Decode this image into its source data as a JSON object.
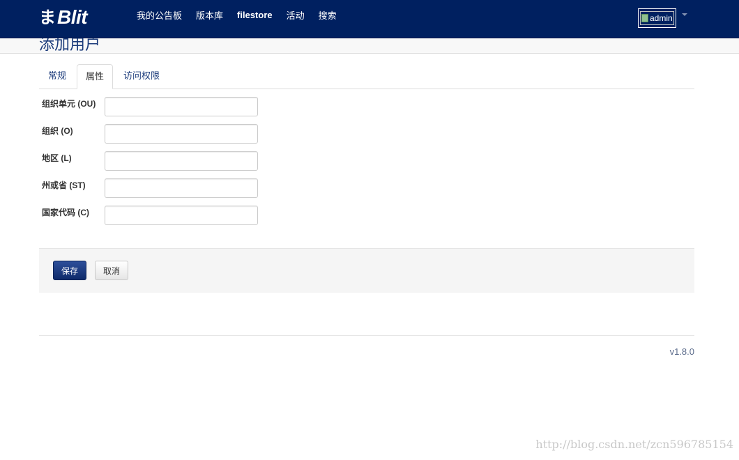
{
  "brand": {
    "glyph": "ま",
    "name": "Blit"
  },
  "nav": {
    "items": [
      {
        "label": "我的公告板"
      },
      {
        "label": "版本库"
      },
      {
        "label": "filestore"
      },
      {
        "label": "活动"
      },
      {
        "label": "搜索"
      }
    ]
  },
  "user": {
    "avatar_alt": "admin"
  },
  "page": {
    "title": "添加用户"
  },
  "tabs": [
    {
      "label": "常规"
    },
    {
      "label": "属性"
    },
    {
      "label": "访问权限"
    }
  ],
  "active_tab": "属性",
  "form": {
    "fields": [
      {
        "label": "组织单元 (OU)",
        "value": "",
        "placeholder": ""
      },
      {
        "label": "组织 (O)",
        "value": "",
        "placeholder": ""
      },
      {
        "label": "地区 (L)",
        "value": "",
        "placeholder": ""
      },
      {
        "label": "州或省 (ST)",
        "value": "",
        "placeholder": ""
      },
      {
        "label": "国家代码 (C)",
        "value": "",
        "placeholder": ""
      }
    ]
  },
  "actions": {
    "save_label": "保存",
    "cancel_label": "取消"
  },
  "footer": {
    "version": "v1.8.0"
  },
  "watermark": "http://blog.csdn.net/zcn596785154",
  "colors": {
    "navbar": "#002060",
    "accent": "#1a3a7a",
    "primary_button": "#0e2a6a"
  }
}
